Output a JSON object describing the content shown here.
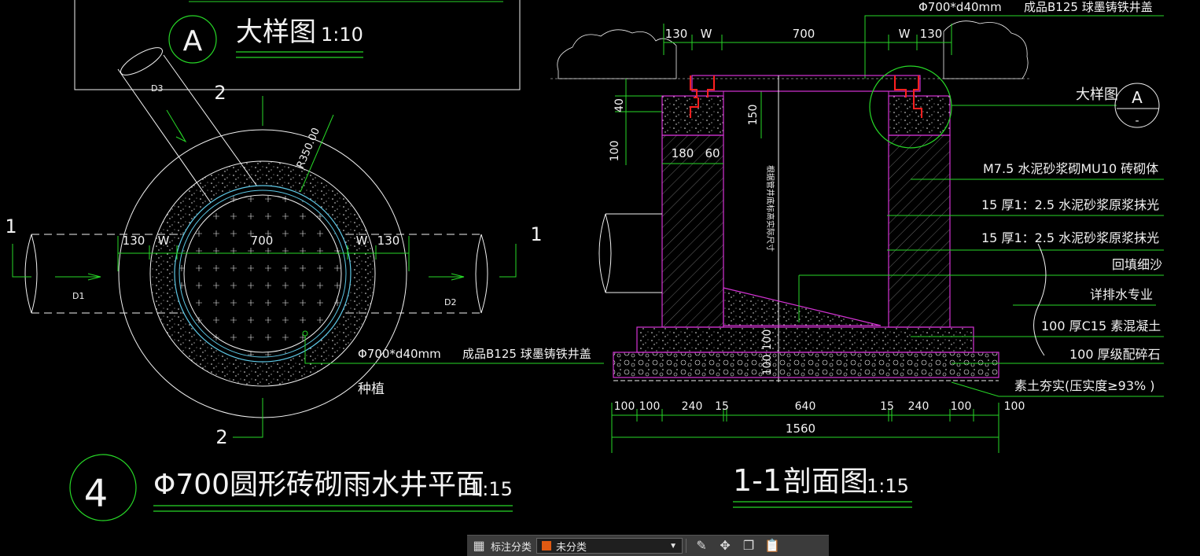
{
  "colors": {
    "green": "#27d827",
    "magenta": "#d433d4",
    "white": "#f2f2f2",
    "cyan": "#5ec8e6",
    "red": "#ff2020",
    "accent": "#e05a12"
  },
  "detail_label": {
    "letter": "A",
    "title": "大样图",
    "scale": "1:10"
  },
  "plan": {
    "number": "4",
    "title": "Φ700圆形砖砌雨水井平面",
    "scale": "1:15",
    "radius_label": "R350.00",
    "dims": [
      "130",
      "W",
      "700",
      "W",
      "130"
    ],
    "pipes": [
      "D1",
      "D2",
      "D3"
    ],
    "cut_marks": [
      "1",
      "1",
      "2",
      "2"
    ],
    "cover_note_a": "Φ700*d40mm",
    "cover_note_b": "成品B125  球墨铸铁井盖",
    "planting": "种植"
  },
  "section": {
    "number": "1-1",
    "title": "剖面图",
    "scale": "1:15",
    "top_dims": [
      "130",
      "W",
      "700",
      "W",
      "130"
    ],
    "top_note_a": "Φ700*d40mm",
    "top_note_b": "成品B125  球墨铸铁井盖",
    "left_dims": [
      "40",
      "100",
      "150"
    ],
    "inner_dims": [
      "180",
      "60"
    ],
    "vertical_note": "根据管井底标高实际尺寸",
    "base_dims": [
      "100",
      "100"
    ],
    "bottom_dims": [
      "100",
      "100",
      "240",
      "15",
      "640",
      "15",
      "240",
      "100",
      "100"
    ],
    "total": "1560",
    "detail_ref": "大样图",
    "detail_ref_letter": "A",
    "detail_ref_sub": "-",
    "labels": [
      "M7.5  水泥砂浆砌MU10  砖砌体",
      "15 厚1：2.5 水泥砂浆原浆抹光",
      "15 厚1：2.5 水泥砂浆原浆抹光",
      "回填细沙",
      "详排水专业",
      "100  厚C15  素混凝土",
      "100  厚级配碎石",
      "素土夯实(压实度≥93% )"
    ]
  },
  "toolbar": {
    "layout_icon": "grid-icon",
    "label": "标注分类",
    "select_value": "未分类",
    "select_color": "#e05a12",
    "tools": [
      {
        "name": "edit-icon",
        "glyph": "✎"
      },
      {
        "name": "move-icon",
        "glyph": "✥"
      },
      {
        "name": "copy-icon",
        "glyph": "❐"
      },
      {
        "name": "paste-icon",
        "glyph": "📋"
      }
    ]
  }
}
